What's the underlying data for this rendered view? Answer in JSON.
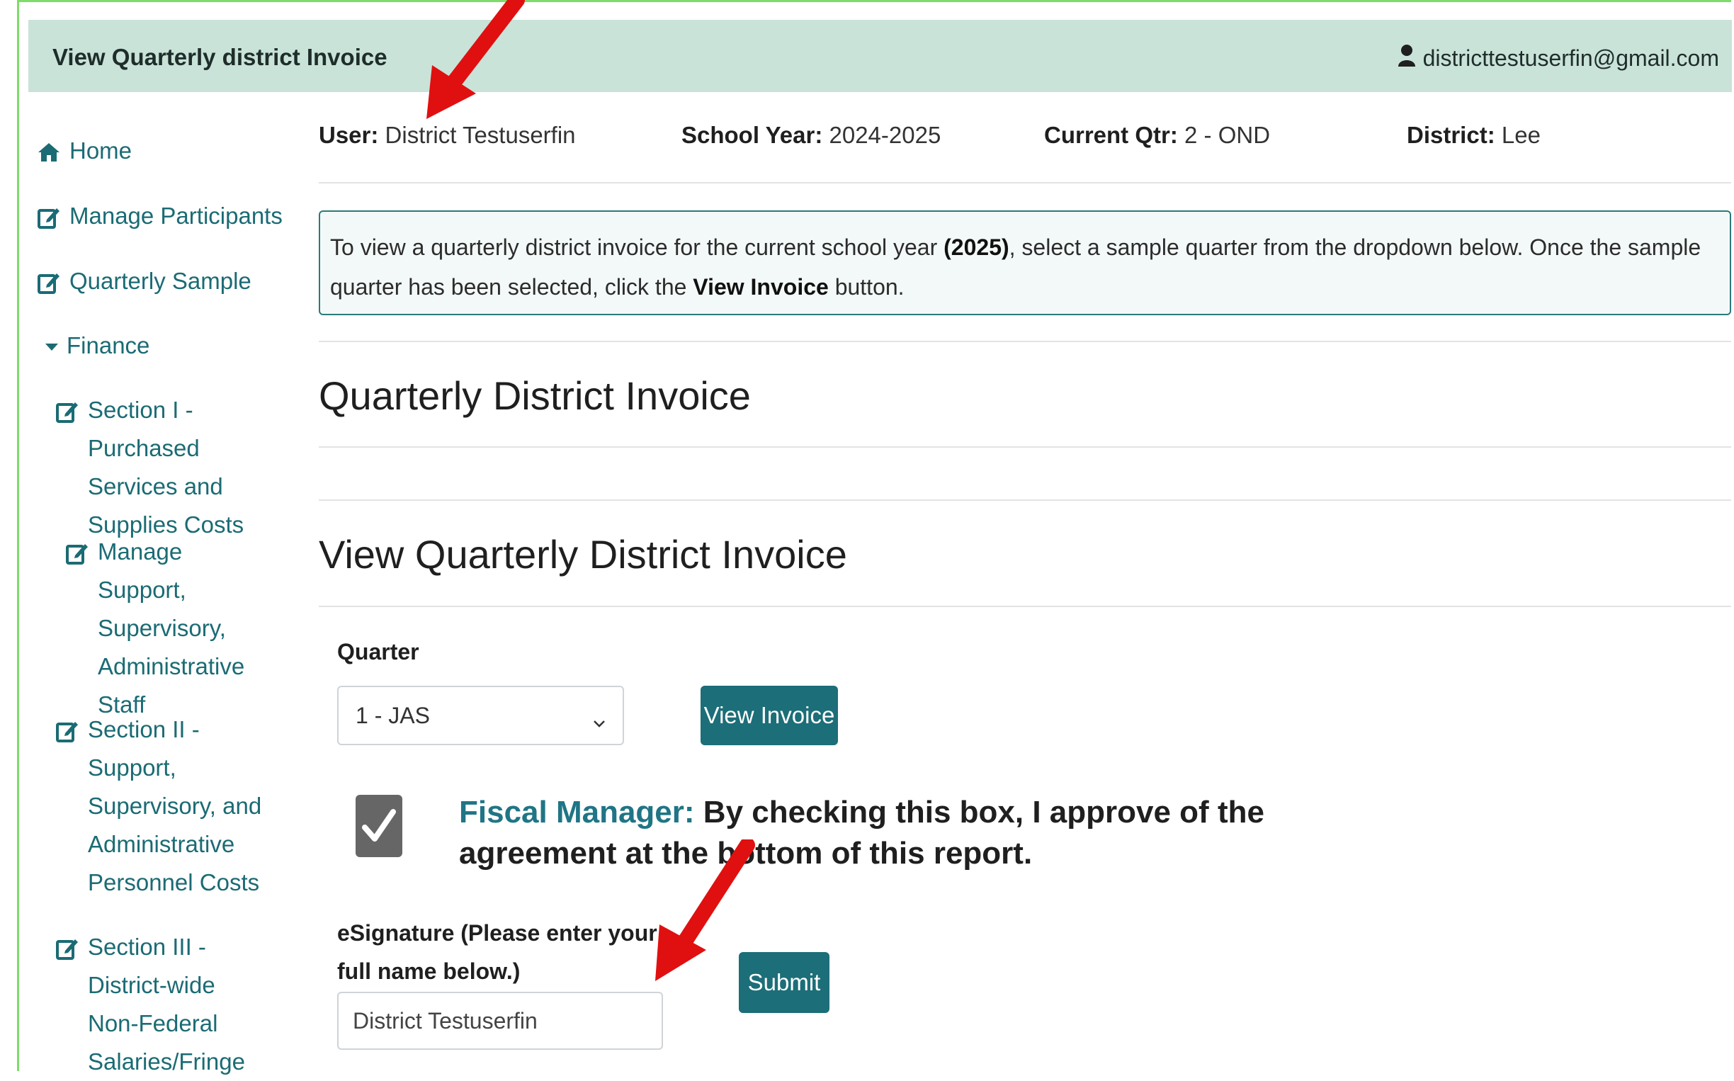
{
  "header": {
    "title": "View Quarterly district Invoice",
    "user_email": "districttestuserfin@gmail.com",
    "user_icon": "user-icon"
  },
  "sidebar": {
    "items": [
      {
        "label": "Home",
        "icon": "home-icon"
      },
      {
        "label": "Manage Participants",
        "icon": "edit-icon"
      },
      {
        "label": "Quarterly Sample",
        "icon": "edit-icon"
      },
      {
        "label": "Finance",
        "icon": "caret-down-icon"
      },
      {
        "label": "Section I - Purchased Services and Supplies Costs",
        "icon": "edit-icon"
      },
      {
        "label": "Manage Support, Supervisory, Administrative Staff",
        "icon": "edit-icon"
      },
      {
        "label": "Section II - Support, Supervisory, and Administrative Personnel Costs",
        "icon": "edit-icon"
      },
      {
        "label": "Section III - District-wide Non-Federal Salaries/Fringe",
        "icon": "edit-icon"
      }
    ]
  },
  "meta": {
    "user_label": "User:",
    "user_value": "District Testuserfin",
    "school_year_label": "School Year:",
    "school_year_value": "2024-2025",
    "current_qtr_label": "Current Qtr:",
    "current_qtr_value": "2 - OND",
    "district_label": "District:",
    "district_value": "Lee"
  },
  "info": {
    "part1": "To view a quarterly district invoice for the current school year ",
    "year": "(2025)",
    "part2": ", select a sample quarter from the dropdown below. Once the sample quarter has been selected, click the ",
    "button_ref": "View Invoice",
    "part3": " button."
  },
  "main": {
    "heading1": "Quarterly District Invoice",
    "heading2": "View Quarterly District Invoice",
    "quarter_label": "Quarter",
    "quarter_selected": "1 - JAS",
    "view_invoice_label": "View Invoice",
    "agreement_role": "Fiscal Manager:",
    "agreement_text": " By checking this box, I approve of the agreement at the bottom of this report.",
    "agreement_checked": true,
    "esignature_label": "eSignature (Please enter your full name below.)",
    "esignature_value": "District Testuserfin",
    "submit_label": "Submit"
  },
  "colors": {
    "accent": "#1c6e78",
    "topbar": "#c9e3d9",
    "link": "#1b6b74",
    "annotation_arrow": "#e01010"
  }
}
